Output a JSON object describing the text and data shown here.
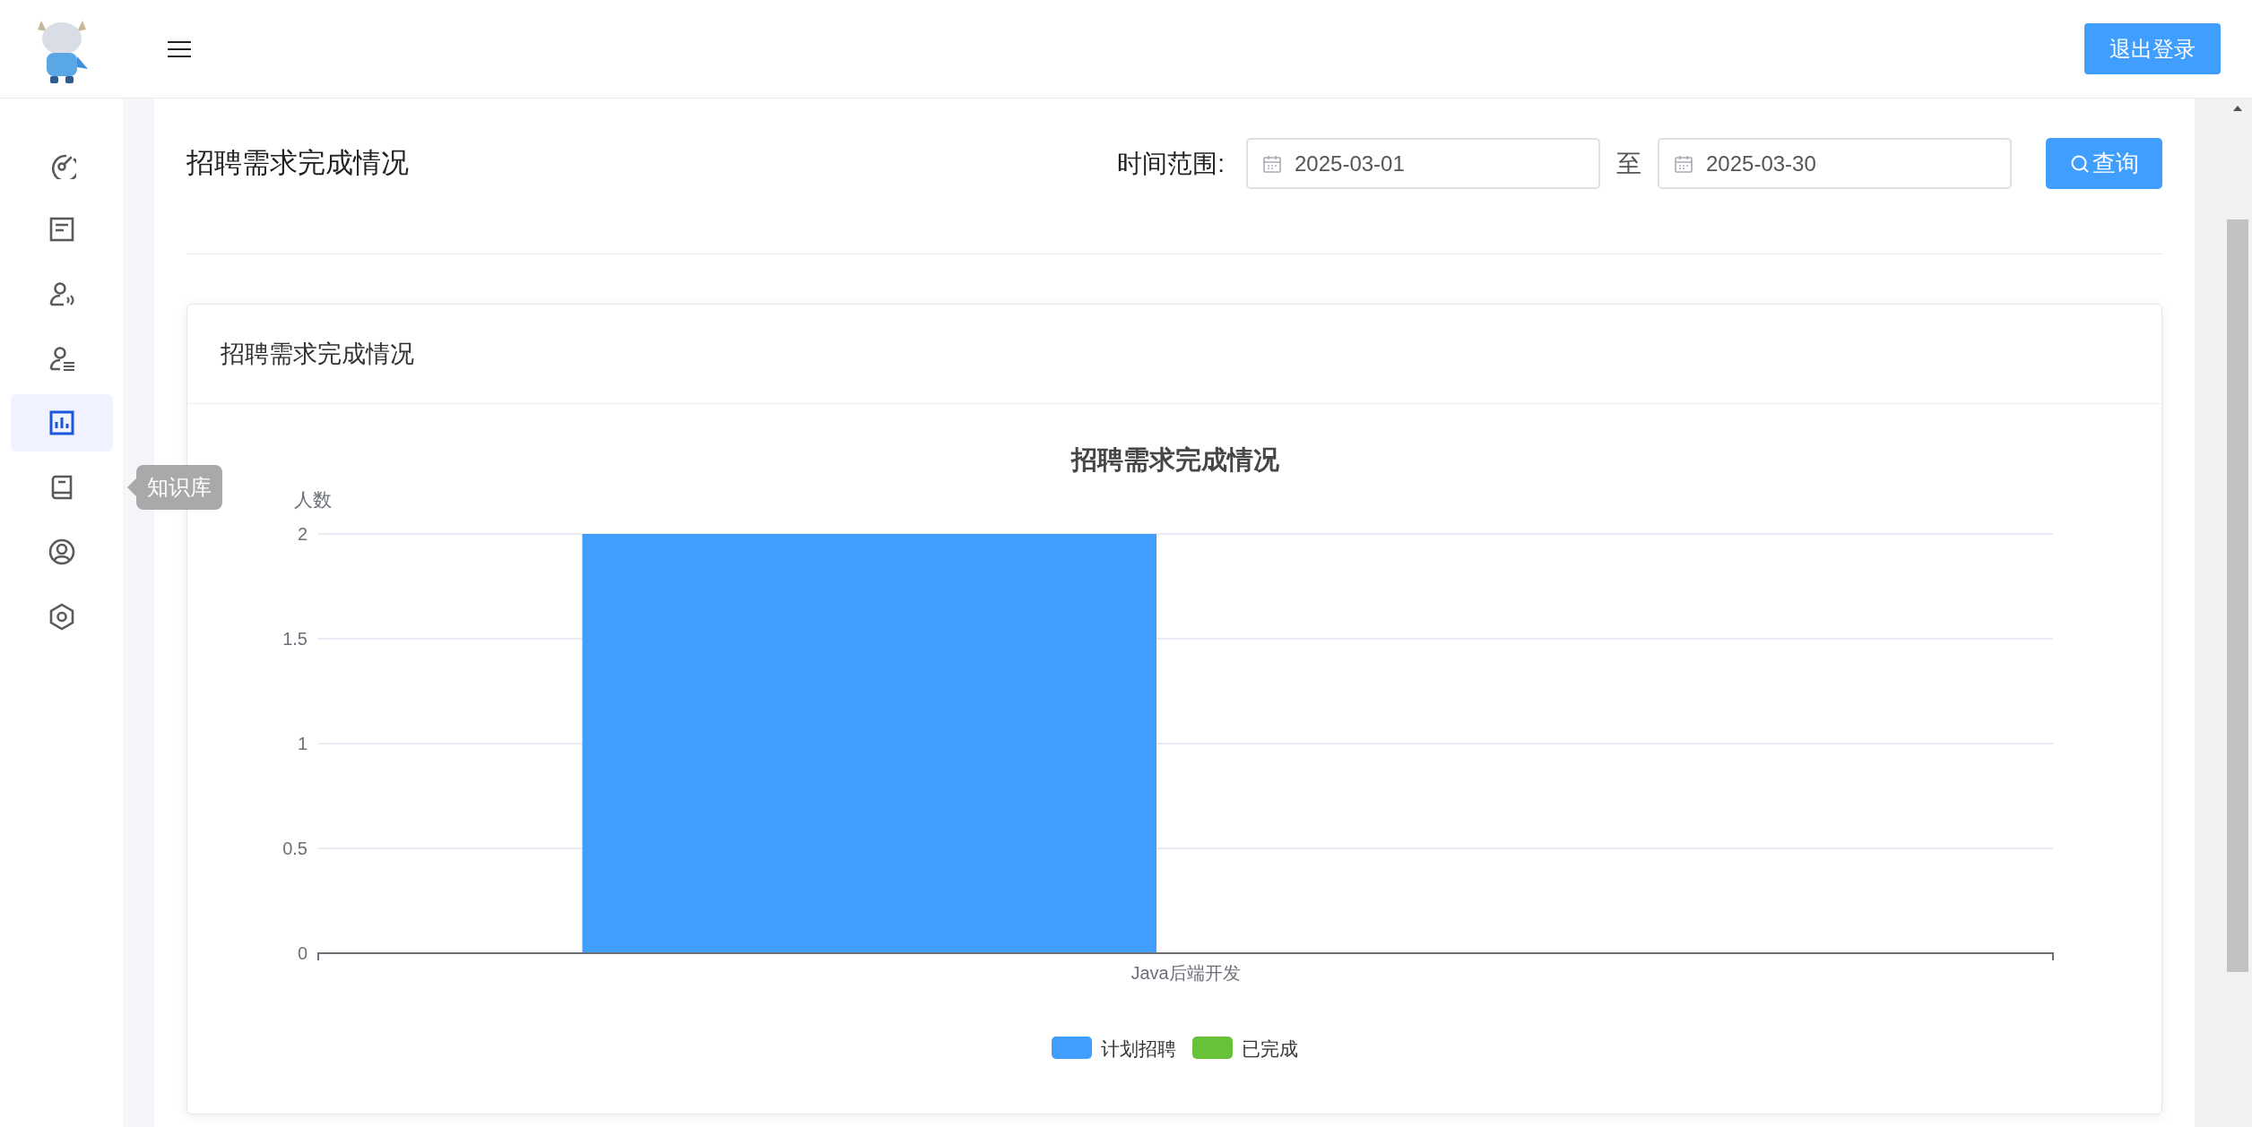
{
  "header": {
    "logout_button": "退出登录"
  },
  "sidebar": {
    "items": [
      {
        "selected": false
      },
      {
        "selected": false
      },
      {
        "selected": false
      },
      {
        "selected": false
      },
      {
        "selected": true
      },
      {
        "selected": false,
        "tooltip": "知识库"
      },
      {
        "selected": false
      },
      {
        "selected": false
      }
    ]
  },
  "toolbar": {
    "title": "招聘需求完成情况",
    "range_label": "时间范围:",
    "start_date": "2025-03-01",
    "separator": "至",
    "end_date": "2025-03-30",
    "query_button": "查询"
  },
  "card": {
    "title": "招聘需求完成情况",
    "chart_data": {
      "type": "bar",
      "title": "招聘需求完成情况",
      "ylabel": "人数",
      "categories": [
        "Java后端开发"
      ],
      "series": [
        {
          "name": "计划招聘",
          "color": "#409eff",
          "values": [
            2
          ]
        },
        {
          "name": "已完成",
          "color": "#67c23a",
          "values": [
            0
          ]
        }
      ],
      "ylim": [
        0,
        2
      ],
      "yticks": [
        0,
        0.5,
        1,
        1.5,
        2
      ],
      "grid": true
    }
  }
}
